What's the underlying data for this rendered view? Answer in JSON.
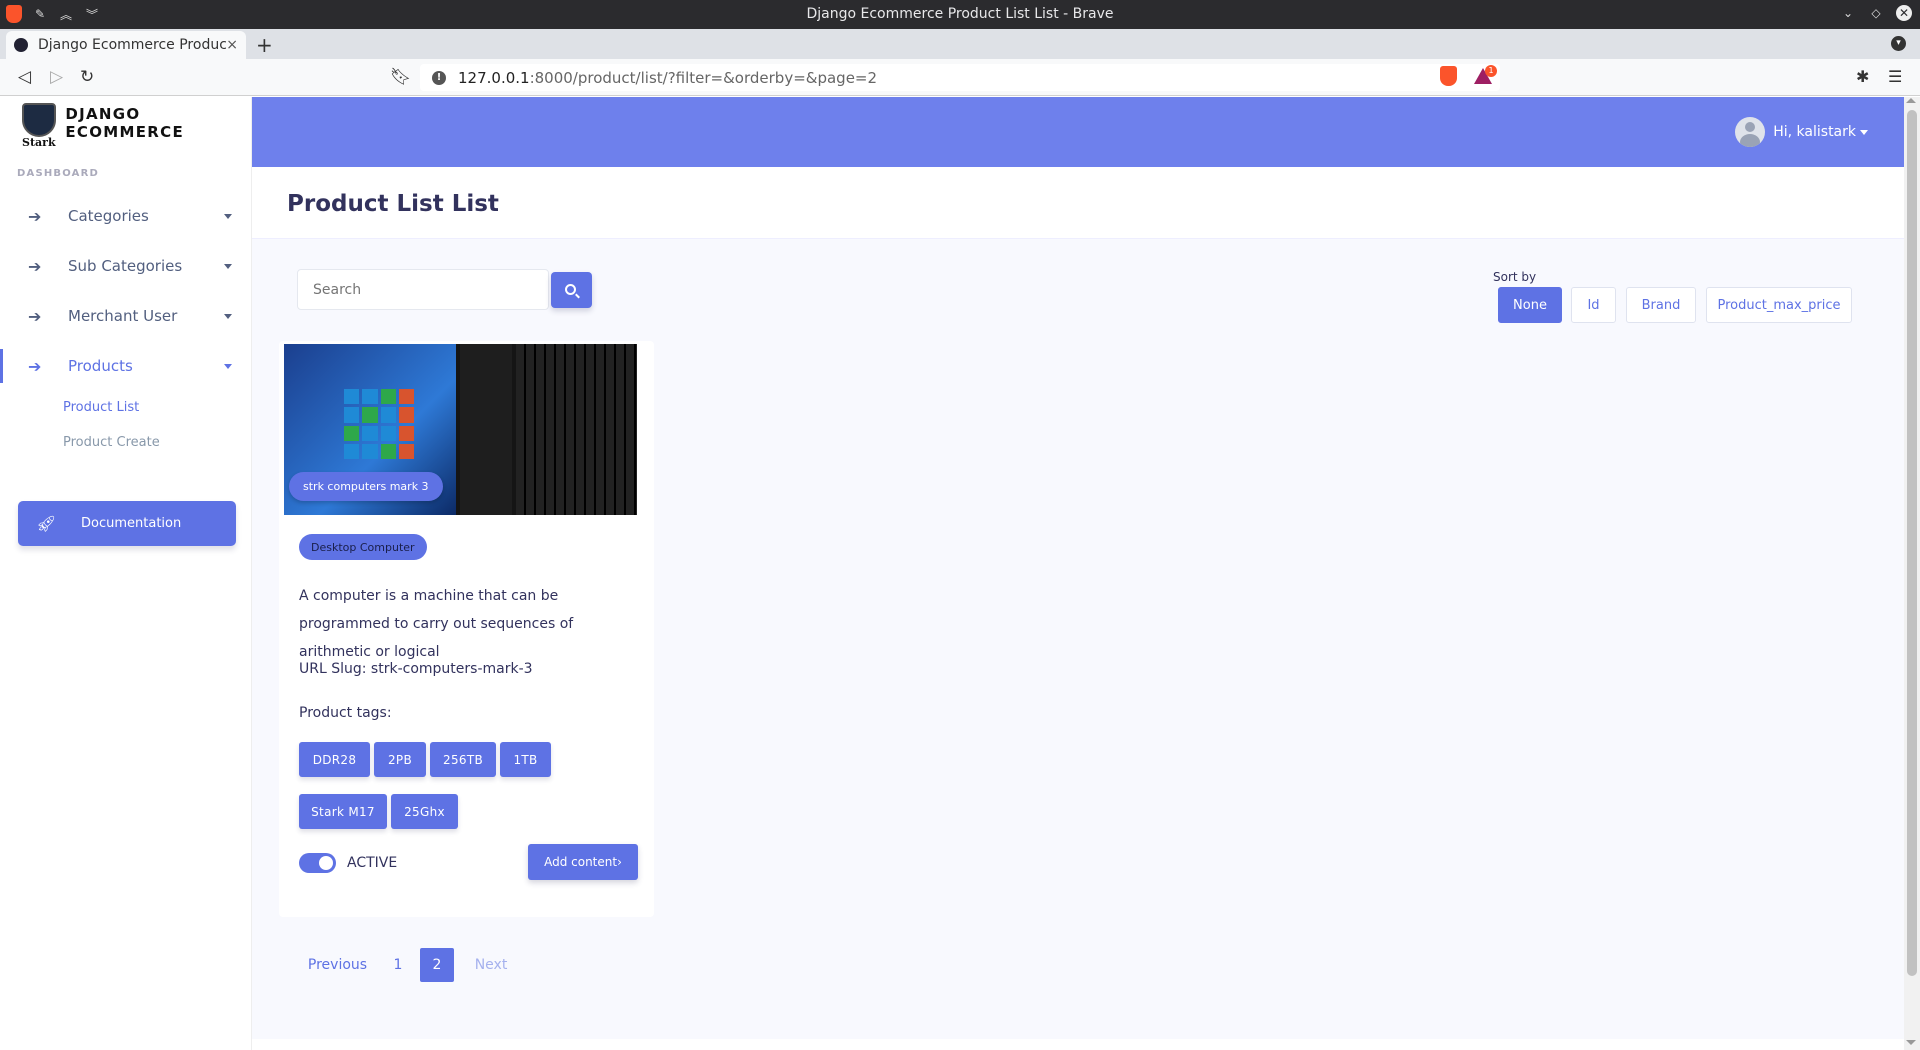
{
  "window": {
    "title": "Django Ecommerce Product List List - Brave"
  },
  "tab": {
    "label": "Django Ecommerce Product",
    "close": "×",
    "new": "+"
  },
  "address": {
    "host": "127.0.0.1",
    "path": ":8000/product/list/?filter=&orderby=&page=2",
    "bat_badge": "1"
  },
  "sidebar": {
    "brand_logo_text": "Stark",
    "brand_name": "DJANGO ECOMMERCE",
    "heading": "DASHBOARD",
    "items": [
      {
        "label": "Categories",
        "icon": "arrow-right-icon"
      },
      {
        "label": "Sub Categories",
        "icon": "arrow-right-icon"
      },
      {
        "label": "Merchant User",
        "icon": "arrow-right-icon"
      },
      {
        "label": "Products",
        "icon": "arrow-right-icon",
        "active": true
      }
    ],
    "subitems": [
      {
        "label": "Product List",
        "active": true
      },
      {
        "label": "Product Create"
      }
    ],
    "doc_button": "Documentation"
  },
  "topnav": {
    "user_label": "Hi, kalistark"
  },
  "page": {
    "title": "Product List List"
  },
  "search": {
    "placeholder": "Search"
  },
  "sort": {
    "label": "Sort by",
    "options": [
      "None",
      "Id",
      "Brand",
      "Product_max_price"
    ],
    "selected": "None"
  },
  "product": {
    "name": "strk computers mark 3",
    "category": "Desktop Computer",
    "description": "A computer is a machine that can be programmed to carry out sequences of arithmetic or logical",
    "slug": "URL Slug: strk-computers-mark-3",
    "tags_label": "Product tags:",
    "tags": [
      "DDR28",
      "2PB",
      "256TB",
      "1TB",
      "Stark M17",
      "25Ghx"
    ],
    "status": "ACTIVE",
    "active": true,
    "add_button": "Add content"
  },
  "pagination": {
    "previous": "Previous",
    "pages": [
      "1",
      "2"
    ],
    "current": "2",
    "next": "Next"
  },
  "colors": {
    "primary": "#5e72e4",
    "topnav": "#6e80ec",
    "background": "#f8f9fe"
  }
}
